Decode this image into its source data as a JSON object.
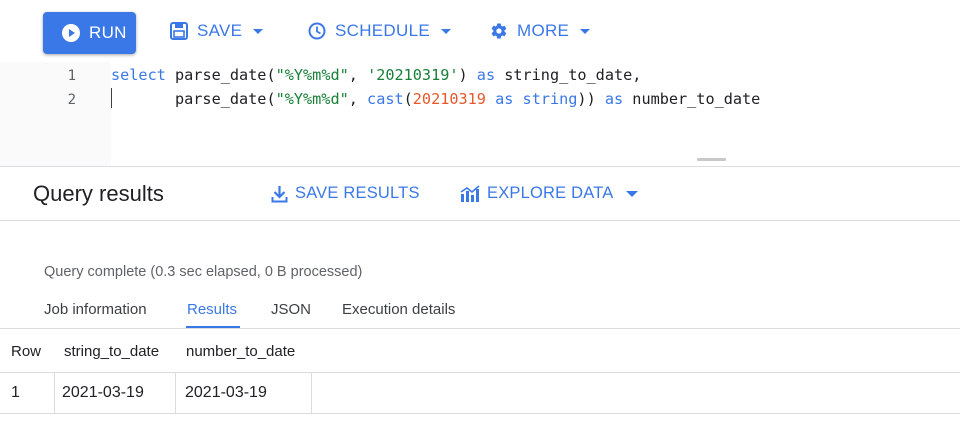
{
  "toolbar": {
    "run_label": "RUN",
    "save_label": "SAVE",
    "schedule_label": "SCHEDULE",
    "more_label": "MORE"
  },
  "editor": {
    "lines": [
      {
        "number": "1",
        "tokens": [
          {
            "text": "select",
            "kind": "keyword"
          },
          {
            "text": " parse_date(",
            "kind": "plain"
          },
          {
            "text": "\"%Y%m%d\"",
            "kind": "string"
          },
          {
            "text": ", ",
            "kind": "plain"
          },
          {
            "text": "'20210319'",
            "kind": "string"
          },
          {
            "text": ") ",
            "kind": "plain"
          },
          {
            "text": "as",
            "kind": "keyword"
          },
          {
            "text": " string_to_date,",
            "kind": "plain"
          }
        ]
      },
      {
        "number": "2",
        "tokens": [
          {
            "text": "       parse_date(",
            "kind": "plain"
          },
          {
            "text": "\"%Y%m%d\"",
            "kind": "string"
          },
          {
            "text": ", ",
            "kind": "plain"
          },
          {
            "text": "cast",
            "kind": "keyword"
          },
          {
            "text": "(",
            "kind": "plain"
          },
          {
            "text": "20210319",
            "kind": "number"
          },
          {
            "text": " ",
            "kind": "plain"
          },
          {
            "text": "as",
            "kind": "keyword"
          },
          {
            "text": " ",
            "kind": "plain"
          },
          {
            "text": "string",
            "kind": "keyword"
          },
          {
            "text": ")) ",
            "kind": "plain"
          },
          {
            "text": "as",
            "kind": "keyword"
          },
          {
            "text": " number_to_date",
            "kind": "plain"
          }
        ]
      }
    ]
  },
  "results": {
    "title": "Query results",
    "save_results_label": "SAVE RESULTS",
    "explore_data_label": "EXPLORE DATA",
    "status": "Query complete (0.3 sec elapsed, 0 B processed)",
    "tabs": [
      {
        "label": "Job information",
        "active": false
      },
      {
        "label": "Results",
        "active": true
      },
      {
        "label": "JSON",
        "active": false
      },
      {
        "label": "Execution details",
        "active": false
      }
    ],
    "table": {
      "headers": [
        "Row",
        "string_to_date",
        "number_to_date"
      ],
      "rows": [
        [
          "1",
          "2021-03-19",
          "2021-03-19"
        ]
      ]
    }
  },
  "colors": {
    "accent": "#3b78e7",
    "keyword": "#3b78e7",
    "string": "#188038",
    "number": "#e8572a"
  },
  "icons": {
    "run": "play-circle-icon",
    "save": "save-icon",
    "schedule": "clock-icon",
    "more": "gear-icon",
    "save_results": "download-icon",
    "explore_data": "chart-icon"
  }
}
